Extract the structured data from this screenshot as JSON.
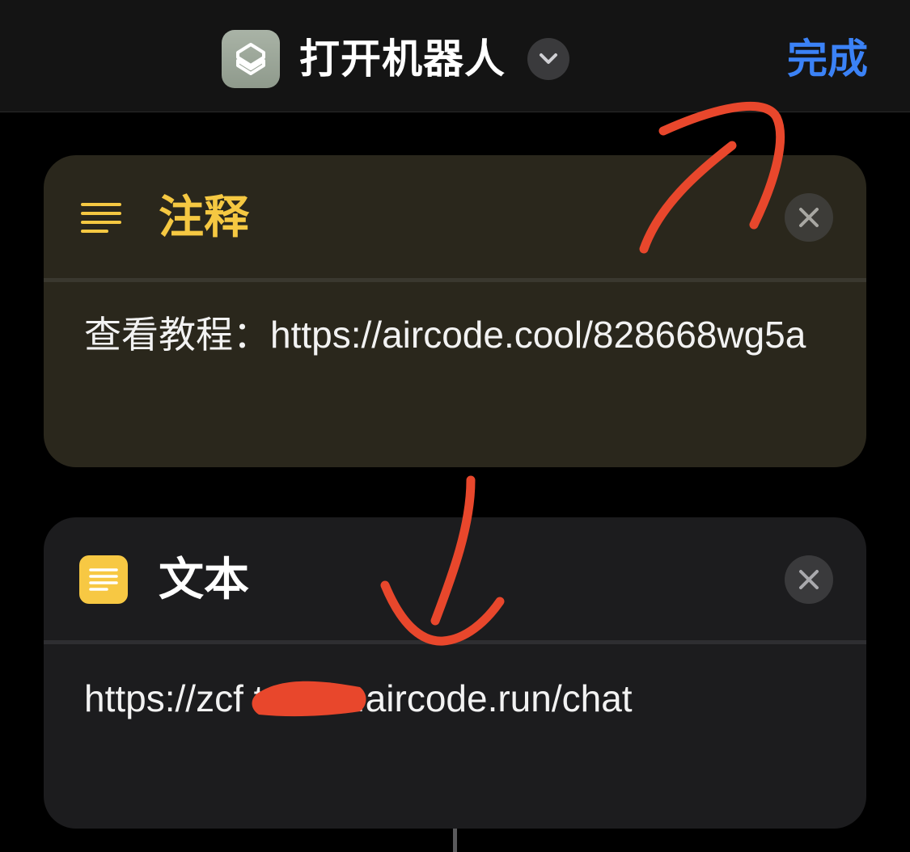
{
  "nav": {
    "title": "打开机器人",
    "done_label": "完成",
    "app_icon": "shortcuts-icon",
    "menu_icon": "chevron-down-icon"
  },
  "actions": [
    {
      "type": "comment",
      "title": "注释",
      "icon": "lines-icon",
      "body": "查看教程：https://aircode.cool/828668wg5a",
      "accent": "#f5c842"
    },
    {
      "type": "text",
      "title": "文本",
      "icon": "text-document-icon",
      "body": "https://zcf         tn4.hk.aircode.run/chat",
      "accent": "#f7c843"
    }
  ],
  "colors": {
    "background": "#000000",
    "nav_background": "#141414",
    "link_blue": "#3b82f6",
    "comment_card": "#2a271c",
    "text_card": "#1c1c1e",
    "annotation_red": "#e8472c"
  }
}
